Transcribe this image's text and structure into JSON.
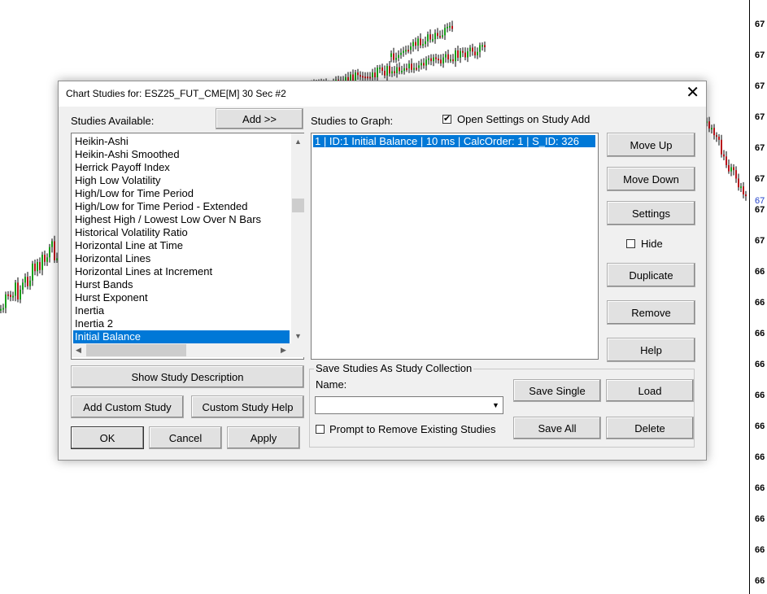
{
  "chart": {
    "price_labels": [
      "67",
      "67",
      "67",
      "67",
      "67",
      "67",
      "67",
      "67",
      "66",
      "66",
      "66",
      "66",
      "66",
      "66",
      "66",
      "66",
      "66",
      "66",
      "66",
      "66"
    ],
    "current_price_label": "67",
    "colors": {
      "up": "#17a01a",
      "down": "#b8141b",
      "wick": "#000000",
      "current": "#1f3fc9"
    }
  },
  "dialog": {
    "title": "Chart Studies for: ESZ25_FUT_CME[M]  30 Sec  #2",
    "close_symbol": "✕",
    "studies_available_label": "Studies Available:",
    "add_button": "Add >>",
    "studies_available": [
      "Heikin-Ashi",
      "Heikin-Ashi Smoothed",
      "Herrick Payoff Index",
      "High Low Volatility",
      "High/Low for Time Period",
      "High/Low for Time Period - Extended",
      "Highest High / Lowest Low Over N Bars",
      "Historical Volatility Ratio",
      "Horizontal Line at Time",
      "Horizontal Lines",
      "Horizontal Lines at Increment",
      "Hurst Bands",
      "Hurst Exponent",
      "Inertia",
      "Inertia 2",
      "Initial Balance"
    ],
    "selected_available_index": 15,
    "studies_to_graph_label": "Studies to Graph:",
    "open_settings_label": "Open Settings on Study Add",
    "open_settings_checked": true,
    "studies_to_graph": [
      "1 | ID:1  Initial Balance | 10 ms | CalcOrder: 1 | S_ID: 326"
    ],
    "move_up_button": "Move Up",
    "move_down_button": "Move Down",
    "settings_button": "Settings",
    "hide_label": "Hide",
    "hide_checked": false,
    "duplicate_button": "Duplicate",
    "remove_button": "Remove",
    "help_button": "Help",
    "show_description_button": "Show Study Description",
    "add_custom_study_button": "Add Custom Study",
    "custom_study_help_button": "Custom Study Help",
    "ok_button": "OK",
    "cancel_button": "Cancel",
    "apply_button": "Apply",
    "collection": {
      "group_title": "Save Studies As Study Collection",
      "name_label": "Name:",
      "name_value": "",
      "save_single_button": "Save Single",
      "load_button": "Load",
      "save_all_button": "Save All",
      "delete_button": "Delete",
      "prompt_label": "Prompt to Remove Existing Studies",
      "prompt_checked": false
    }
  }
}
